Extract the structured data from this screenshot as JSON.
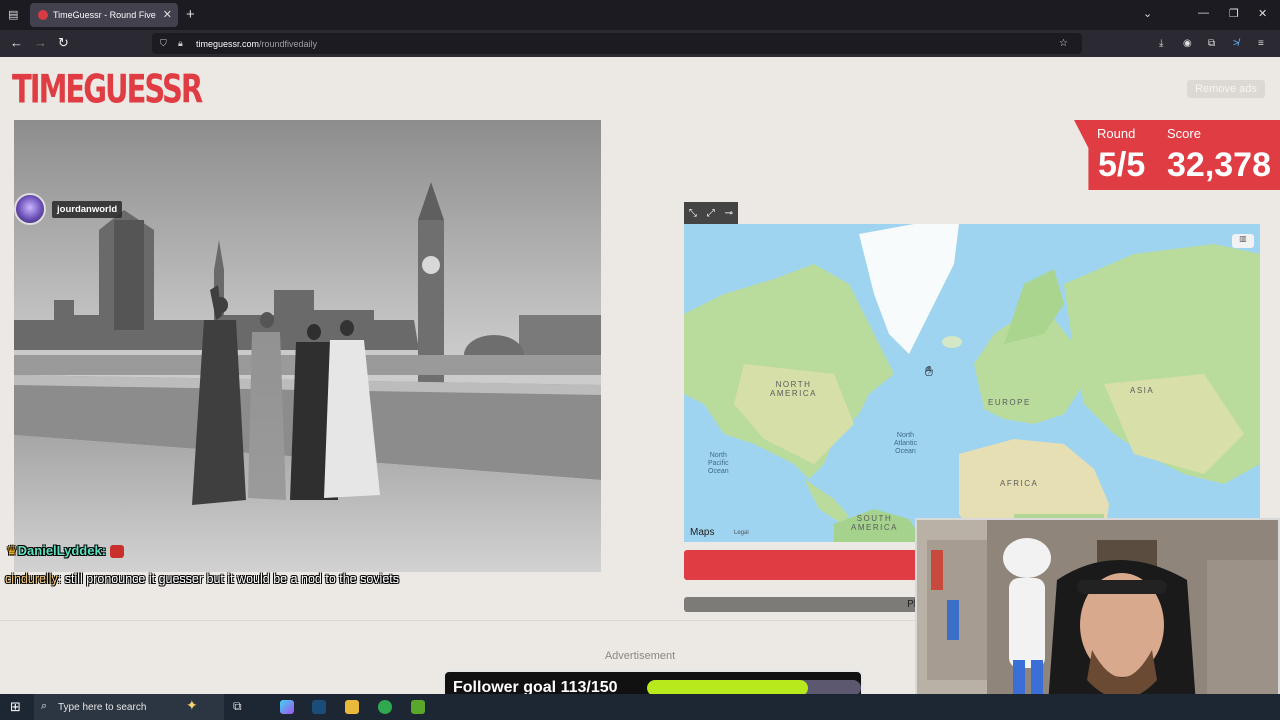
{
  "browser": {
    "tab_title": "TimeGuessr - Round Five",
    "url_domain": "timeguessr.com",
    "url_path": "/roundfivedaily"
  },
  "page": {
    "logo": "TIMEGUESSR",
    "remove_ads": "Remove ads",
    "round_label": "Round",
    "round_value": "5/5",
    "score_label": "Score",
    "score_value": "32,378",
    "map_attribution": "Maps",
    "map_legal": "Legal",
    "progress_text": "Pl",
    "advertisement": "Advertisement",
    "map_labels": {
      "north_america": "NORTH\nAMERICA",
      "europe": "EUROPE",
      "asia": "ASIA",
      "africa": "AFRICA",
      "south_america": "SOUTH\nAMERICA",
      "north_atlantic": "North\nAtlantic\nOcean",
      "north_pacific": "North\nPacific\nOcean"
    }
  },
  "stream": {
    "streamer_name": "jourdanworld",
    "chat": [
      {
        "user": "DanielLyddek:",
        "message": ""
      },
      {
        "user": "cindurelly:",
        "message": "still pronounce it guesser but it would be a nod to the soviets"
      }
    ],
    "follower_goal_label": "Follower goal 113/150",
    "follower_goal_fraction": 0.7533
  },
  "taskbar": {
    "search_placeholder": "Type here to search"
  },
  "colors": {
    "brand_red": "#e03c43",
    "goal_fill": "#b8e91c",
    "ocean": "#9fd4f0",
    "land": "#b9dc9c"
  }
}
